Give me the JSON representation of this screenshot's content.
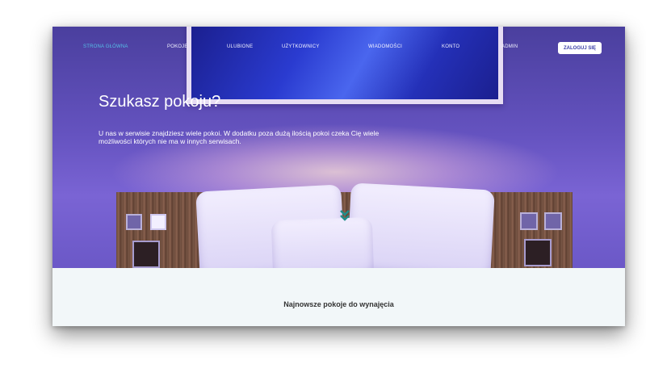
{
  "nav": {
    "items": [
      {
        "label": "Strona Główna",
        "active": true
      },
      {
        "label": "Pokoje"
      },
      {
        "label": "Ulubione"
      },
      {
        "label": "Użytkownicy"
      },
      {
        "label": "Wiadomości"
      },
      {
        "label": "Konto"
      },
      {
        "label": "Admin"
      }
    ],
    "login_label": "ZALOGUJ SIĘ"
  },
  "hero": {
    "title": "Szukasz pokoju?",
    "description": "U nas w serwisie znajdziesz wiele pokoi. W dodatku poza dużą ilością pokoi czeka Cię wiele możliwości których nie ma w innych serwisach.",
    "scroll_icon": "chevron-double-down-icon"
  },
  "section": {
    "title": "Najnowsze pokoje do wynajęcia"
  },
  "colors": {
    "accent": "#56bfe7",
    "hero_overlay": "#6553c0",
    "section_bg": "#f2f7f9"
  }
}
